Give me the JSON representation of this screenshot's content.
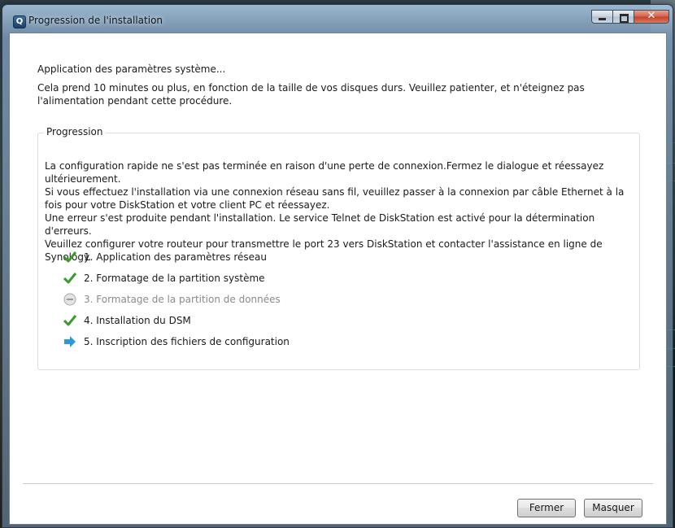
{
  "window": {
    "title": "Progression de l'installation",
    "app_icon_glyph": "Q"
  },
  "heading": "Application des paramètres système...",
  "description": "Cela prend 10 minutes ou plus, en fonction de la taille de vos disques durs. Veuillez patienter, et n'éteignez pas l'alimentation pendant cette procédure.",
  "progress_group": {
    "title": "Progression",
    "message_lines": [
      "La configuration rapide ne s'est pas terminée en raison d'une perte de connexion.Fermez le dialogue et réessayez ultérieurement.",
      "Si vous effectuez l'installation via une connexion réseau sans fil, veuillez passer à la connexion par câble Ethernet à la fois pour votre DiskStation et votre client PC et réessayez.",
      "Une erreur s'est produite pendant l'installation. Le service Telnet de DiskStation est activé pour la détermination d'erreurs.",
      "Veuillez configurer votre routeur pour transmettre le port 23 vers DiskStation et contacter l'assistance en ligne de Synology."
    ],
    "steps": [
      {
        "label": "1. Application des paramètres réseau",
        "status": "done",
        "icon": "checkmark-icon"
      },
      {
        "label": "2. Formatage de la partition système",
        "status": "done",
        "icon": "checkmark-icon"
      },
      {
        "label": "3. Formatage de la partition de données",
        "status": "skipped",
        "icon": "minus-circle-icon"
      },
      {
        "label": "4. Installation du DSM",
        "status": "done",
        "icon": "checkmark-icon"
      },
      {
        "label": "5. Inscription des fichiers de configuration",
        "status": "current",
        "icon": "arrow-right-icon"
      }
    ]
  },
  "buttons": {
    "close_label": "Fermer",
    "hide_label": "Masquer"
  },
  "colors": {
    "check": "#3a9a2a",
    "arrow": "#2a9ad8",
    "disabled": "#8a8a8a"
  }
}
